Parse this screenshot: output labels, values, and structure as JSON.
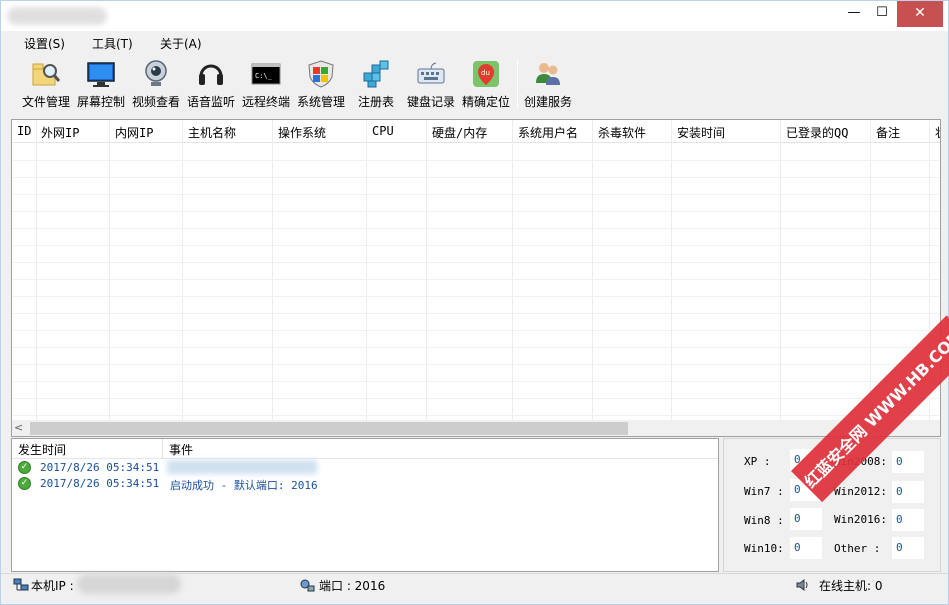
{
  "window": {
    "title": "",
    "controls": {
      "minimize": "—",
      "maximize": "☐",
      "close": "✕"
    }
  },
  "menu": [
    {
      "label": "设置(S)"
    },
    {
      "label": "工具(T)"
    },
    {
      "label": "关于(A)"
    }
  ],
  "toolbar": [
    {
      "label": "文件管理",
      "icon": "folder-magnifier-icon"
    },
    {
      "label": "屏幕控制",
      "icon": "monitor-icon"
    },
    {
      "label": "视频查看",
      "icon": "webcam-icon"
    },
    {
      "label": "语音监听",
      "icon": "headphones-icon"
    },
    {
      "label": "远程终端",
      "icon": "terminal-icon",
      "icon_text": "C:\\_"
    },
    {
      "label": "系统管理",
      "icon": "windows-shield-icon"
    },
    {
      "label": "注册表",
      "icon": "registry-cubes-icon"
    },
    {
      "label": "键盘记录",
      "icon": "keyboard-icon"
    },
    {
      "label": "精确定位",
      "icon": "map-pin-icon",
      "icon_text": "du"
    },
    {
      "label": "创建服务",
      "icon": "users-icon"
    }
  ],
  "host_table": {
    "columns": [
      "ID",
      "外网IP",
      "内网IP",
      "主机名称",
      "操作系统",
      "CPU",
      "硬盘/内存",
      "系统用户名",
      "杀毒软件",
      "安装时间",
      "已登录的QQ",
      "备注",
      "状"
    ],
    "rows": []
  },
  "scroll_left": "<",
  "log": {
    "columns": [
      "发生时间",
      "事件"
    ],
    "rows": [
      {
        "time": "2017/8/26 05:34:51",
        "event": ""
      },
      {
        "time": "2017/8/26 05:34:51",
        "event": "启动成功 - 默认端口: 2016"
      }
    ]
  },
  "os_stats": [
    {
      "label": "XP   :",
      "value": "0"
    },
    {
      "label": "Win2008:",
      "value": "0"
    },
    {
      "label": "Win7  :",
      "value": "0"
    },
    {
      "label": "Win2012:",
      "value": "0"
    },
    {
      "label": "Win8  :",
      "value": "0"
    },
    {
      "label": "Win2016:",
      "value": "0"
    },
    {
      "label": "Win10:",
      "value": "0"
    },
    {
      "label": "Other :",
      "value": "0"
    }
  ],
  "status": {
    "local_ip_label": "本机IP :",
    "local_ip_value": "",
    "port_label": "端口 : 2016",
    "online_label": "在线主机: 0"
  },
  "watermark": "红蓝安全网 WWW.HB.COM"
}
